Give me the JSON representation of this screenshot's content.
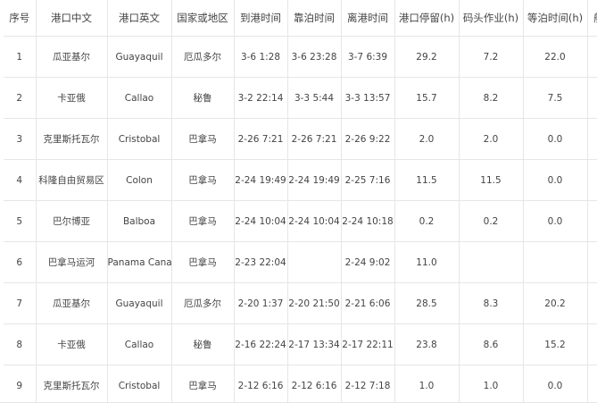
{
  "columns": [
    "序号",
    "港口中文",
    "港口英文",
    "国家或地区",
    "到港时间",
    "靠泊时间",
    "离港时间",
    "港口停留(h)",
    "码头作业(h)",
    "等泊时间(h)",
    "航"
  ],
  "rows": [
    [
      "1",
      "瓜亚基尔",
      "Guayaquil",
      "厄瓜多尔",
      "3-6 1:28",
      "3-6 23:28",
      "3-7 6:39",
      "29.2",
      "7.2",
      "22.0",
      ""
    ],
    [
      "2",
      "卡亚俄",
      "Callao",
      "秘鲁",
      "3-2 22:14",
      "3-3 5:44",
      "3-3 13:57",
      "15.7",
      "8.2",
      "7.5",
      ""
    ],
    [
      "3",
      "克里斯托瓦尔",
      "Cristobal",
      "巴拿马",
      "2-26 7:21",
      "2-26 7:21",
      "2-26 9:22",
      "2.0",
      "2.0",
      "0.0",
      ""
    ],
    [
      "4",
      "科隆自由贸易区",
      "Colon",
      "巴拿马",
      "2-24 19:49",
      "2-24 19:49",
      "2-25 7:16",
      "11.5",
      "11.5",
      "0.0",
      ""
    ],
    [
      "5",
      "巴尔博亚",
      "Balboa",
      "巴拿马",
      "2-24 10:04",
      "2-24 10:04",
      "2-24 10:18",
      "0.2",
      "0.2",
      "0.0",
      ""
    ],
    [
      "6",
      "巴拿马运河",
      "Panama Canal",
      "巴拿马",
      "2-23 22:04",
      "",
      "2-24 9:02",
      "11.0",
      "",
      "",
      ""
    ],
    [
      "7",
      "瓜亚基尔",
      "Guayaquil",
      "厄瓜多尔",
      "2-20 1:37",
      "2-20 21:50",
      "2-21 6:06",
      "28.5",
      "8.3",
      "20.2",
      ""
    ],
    [
      "8",
      "卡亚俄",
      "Callao",
      "秘鲁",
      "2-16 22:24",
      "2-17 13:34",
      "2-17 22:11",
      "23.8",
      "8.6",
      "15.2",
      ""
    ],
    [
      "9",
      "克里斯托瓦尔",
      "Cristobal",
      "巴拿马",
      "2-12 6:16",
      "2-12 6:16",
      "2-12 7:18",
      "1.0",
      "1.0",
      "0.0",
      ""
    ]
  ]
}
